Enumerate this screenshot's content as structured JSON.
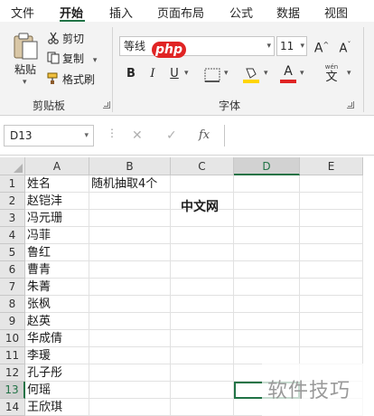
{
  "tabs": [
    "文件",
    "开始",
    "插入",
    "页面布局",
    "公式",
    "数据",
    "视图"
  ],
  "active_tab": "开始",
  "clipboard": {
    "paste_label": "粘贴",
    "cut_label": "剪切",
    "copy_label": "复制",
    "format_painter_label": "格式刷",
    "group_label": "剪贴板"
  },
  "font": {
    "name": "等线",
    "size": "11",
    "grow_label": "A",
    "shrink_label": "A",
    "bold": "B",
    "italic": "I",
    "underline": "U",
    "font_color_letter": "A",
    "phonetic_label": "wén",
    "group_label": "字体",
    "colors": {
      "fill": "#ffd500",
      "font": "#e02424",
      "accent": "#217346"
    }
  },
  "formula_bar": {
    "name_box": "D13",
    "fx_label": "fx",
    "formula": ""
  },
  "grid": {
    "columns": [
      "A",
      "B",
      "C",
      "D",
      "E"
    ],
    "selected_column": "D",
    "selected_row": "13",
    "rows": [
      {
        "num": "1",
        "a": "姓名",
        "b": "随机抽取4个"
      },
      {
        "num": "2",
        "a": "赵铠沣",
        "b": ""
      },
      {
        "num": "3",
        "a": "冯元珊",
        "b": ""
      },
      {
        "num": "4",
        "a": "冯菲",
        "b": ""
      },
      {
        "num": "5",
        "a": "鲁红",
        "b": ""
      },
      {
        "num": "6",
        "a": "曹青",
        "b": ""
      },
      {
        "num": "7",
        "a": "朱菁",
        "b": ""
      },
      {
        "num": "8",
        "a": "张枫",
        "b": ""
      },
      {
        "num": "9",
        "a": "赵英",
        "b": ""
      },
      {
        "num": "10",
        "a": "华成倩",
        "b": ""
      },
      {
        "num": "11",
        "a": "李瑗",
        "b": ""
      },
      {
        "num": "12",
        "a": "孔子彤",
        "b": ""
      },
      {
        "num": "13",
        "a": "何瑶",
        "b": ""
      },
      {
        "num": "14",
        "a": "王欣琪",
        "b": ""
      }
    ]
  },
  "watermarks": {
    "php_badge": "php",
    "php_text": "中文网",
    "bottom_text": "软件技巧"
  }
}
